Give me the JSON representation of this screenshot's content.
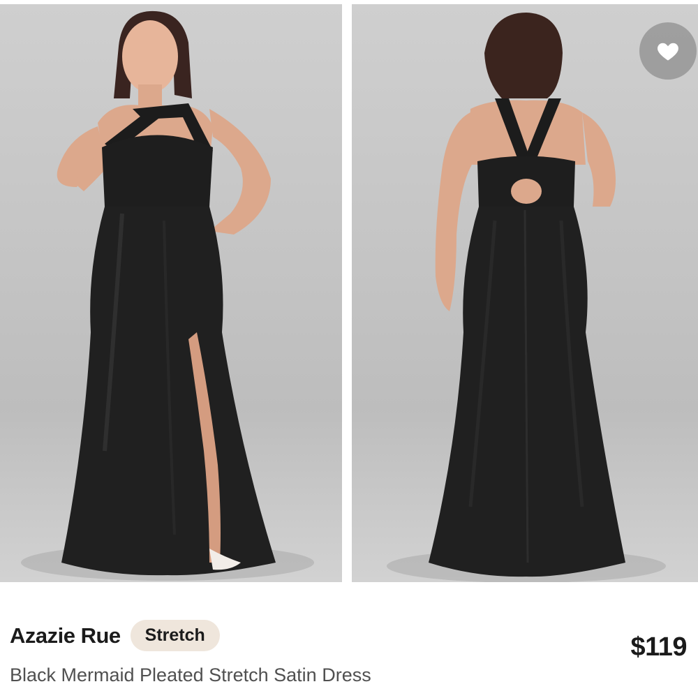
{
  "product": {
    "brand": "Azazie Rue",
    "badge": "Stretch",
    "price": "$119",
    "title": "Black Mermaid Pleated Stretch Satin Dress"
  },
  "gallery": {
    "images": [
      {
        "name": "front-view",
        "description": "Model wearing black halter satin gown with high slit, front view"
      },
      {
        "name": "back-view",
        "description": "Model wearing black halter satin gown, back view with cutout"
      }
    ],
    "favorite_icon": "heart-icon"
  },
  "colors": {
    "background": "#ffffff",
    "badge_bg": "#efe6dc",
    "dress": "#1e1e1e",
    "photo_bg": "#c8c8c8"
  }
}
